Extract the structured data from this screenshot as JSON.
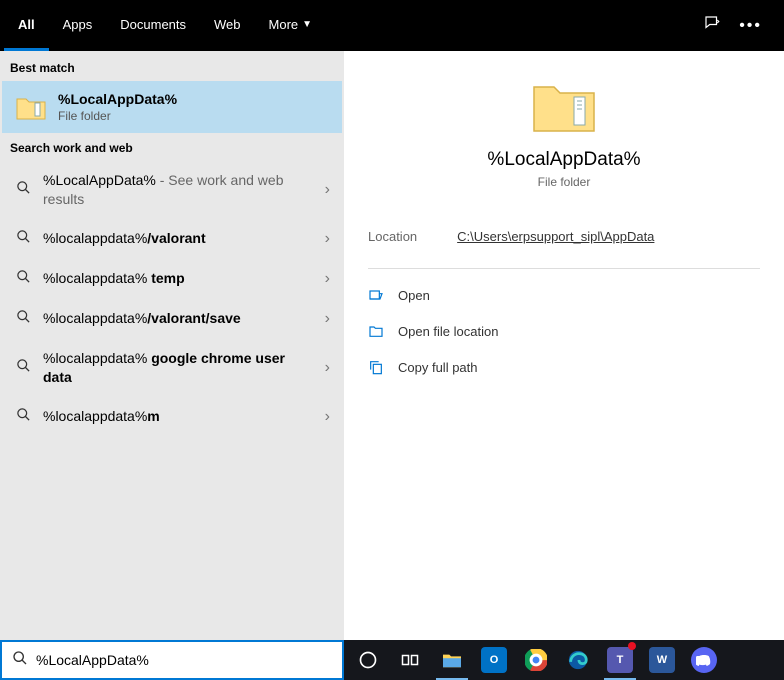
{
  "header": {
    "tabs": [
      "All",
      "Apps",
      "Documents",
      "Web",
      "More"
    ]
  },
  "sections": {
    "best_match_label": "Best match",
    "search_web_label": "Search work and web"
  },
  "best_match": {
    "title": "%LocalAppData%",
    "subtitle": "File folder"
  },
  "suggestions": [
    {
      "prefix": "%LocalAppData%",
      "suffix": "",
      "extra": " - See work and web results"
    },
    {
      "prefix": "%localappdata%",
      "suffix": "/valorant",
      "extra": ""
    },
    {
      "prefix": "%localappdata% ",
      "suffix": "temp",
      "extra": ""
    },
    {
      "prefix": "%localappdata%",
      "suffix": "/valorant/save",
      "extra": ""
    },
    {
      "prefix": "%localappdata% ",
      "suffix": "google chrome user data",
      "extra": ""
    },
    {
      "prefix": "%localappdata%",
      "suffix": "m",
      "extra": ""
    }
  ],
  "preview": {
    "title": "%LocalAppData%",
    "subtitle": "File folder",
    "location_label": "Location",
    "location_value": "C:\\Users\\erpsupport_sipl\\AppData"
  },
  "actions": {
    "open": "Open",
    "open_location": "Open file location",
    "copy_path": "Copy full path"
  },
  "search": {
    "value": "%LocalAppData%"
  }
}
